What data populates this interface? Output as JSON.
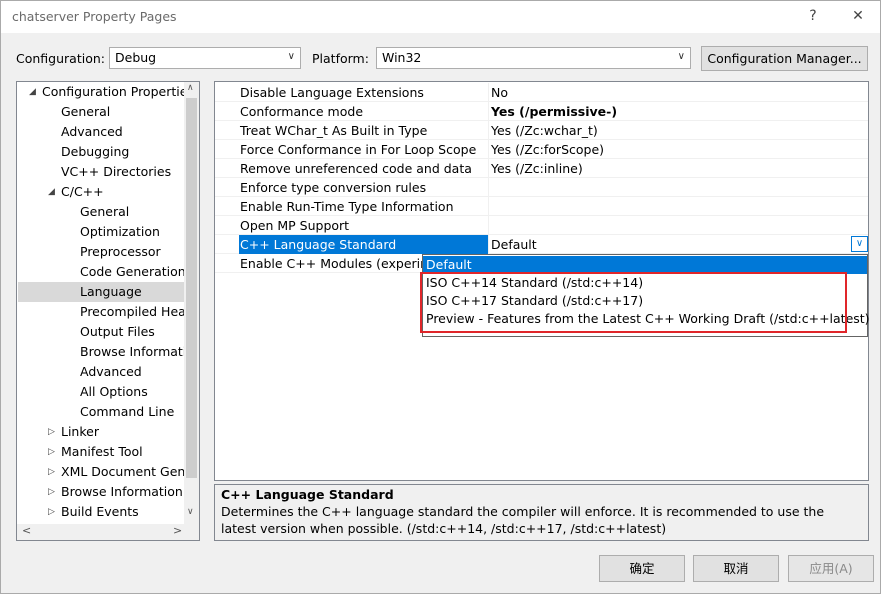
{
  "window": {
    "title": "chatserver Property Pages",
    "help": "?",
    "close": "✕"
  },
  "config": {
    "configuration_label": "Configuration:",
    "configuration_value": "Debug",
    "platform_label": "Platform:",
    "platform_value": "Win32",
    "manager_button": "Configuration Manager..."
  },
  "tree": {
    "items": [
      {
        "label": "Configuration Properties",
        "twisty": "◢"
      },
      {
        "label": "General"
      },
      {
        "label": "Advanced"
      },
      {
        "label": "Debugging"
      },
      {
        "label": "VC++ Directories"
      },
      {
        "label": "C/C++",
        "twisty": "◢"
      },
      {
        "label": "General"
      },
      {
        "label": "Optimization"
      },
      {
        "label": "Preprocessor"
      },
      {
        "label": "Code Generation"
      },
      {
        "label": "Language"
      },
      {
        "label": "Precompiled Heade"
      },
      {
        "label": "Output Files"
      },
      {
        "label": "Browse Informatio"
      },
      {
        "label": "Advanced"
      },
      {
        "label": "All Options"
      },
      {
        "label": "Command Line"
      },
      {
        "label": "Linker",
        "twisty": "▷"
      },
      {
        "label": "Manifest Tool",
        "twisty": "▷"
      },
      {
        "label": "XML Document Gene",
        "twisty": "▷"
      },
      {
        "label": "Browse Information",
        "twisty": "▷"
      },
      {
        "label": "Build Events",
        "twisty": "▷"
      }
    ],
    "scroll_left": "<",
    "scroll_right": ">",
    "scroll_up": "∧",
    "scroll_down": "∨"
  },
  "grid": {
    "rows": [
      {
        "prop": "Disable Language Extensions",
        "value": "No"
      },
      {
        "prop": "Conformance mode",
        "value": "Yes (/permissive-)"
      },
      {
        "prop": "Treat WChar_t As Built in Type",
        "value": "Yes (/Zc:wchar_t)"
      },
      {
        "prop": "Force Conformance in For Loop Scope",
        "value": "Yes (/Zc:forScope)"
      },
      {
        "prop": "Remove unreferenced code and data",
        "value": "Yes (/Zc:inline)"
      },
      {
        "prop": "Enforce type conversion rules",
        "value": ""
      },
      {
        "prop": "Enable Run-Time Type Information",
        "value": ""
      },
      {
        "prop": "Open MP Support",
        "value": ""
      },
      {
        "prop": "C++ Language Standard",
        "value": "Default"
      },
      {
        "prop": "Enable C++ Modules (experimental)",
        "value": ""
      }
    ],
    "dropdown_icon": "chevron-down-icon"
  },
  "dropdown": {
    "options": [
      "Default",
      "ISO C++14 Standard (/std:c++14)",
      "ISO C++17 Standard (/std:c++17)",
      "Preview - Features from the Latest C++ Working Draft (/std:c++latest)"
    ]
  },
  "description": {
    "title": "C++ Language Standard",
    "text": "Determines the C++ language standard the compiler will enforce. It is recommended to use the latest version when possible. (/std:c++14, /std:c++17, /std:c++latest)"
  },
  "buttons": {
    "ok": "确定",
    "cancel": "取消",
    "apply": "应用(A)"
  },
  "colors": {
    "selection": "#0078d7",
    "highlight_box": "#e0262a"
  }
}
